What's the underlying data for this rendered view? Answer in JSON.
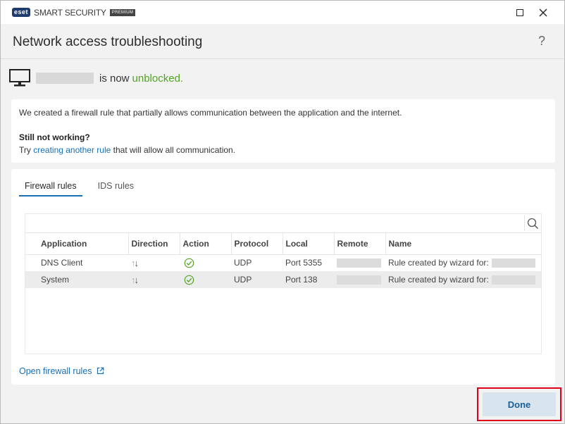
{
  "titlebar": {
    "logo_brand": "eset",
    "logo_product": "SMART SECURITY",
    "logo_edition": "PREMIUM"
  },
  "header": {
    "title": "Network access troubleshooting",
    "help_label": "?"
  },
  "status": {
    "suffix": "is now",
    "state": "unblocked."
  },
  "info": {
    "description": "We created a firewall rule that partially allows communication between the application and the internet.",
    "heading": "Still not working?",
    "try_prefix": "Try",
    "try_link": "creating another rule",
    "try_suffix": "that will allow all communication."
  },
  "tabs": [
    {
      "label": "Firewall rules",
      "active": true
    },
    {
      "label": "IDS rules",
      "active": false
    }
  ],
  "table": {
    "columns": [
      "Application",
      "Direction",
      "Action",
      "Protocol",
      "Local",
      "Remote",
      "Name"
    ],
    "rows": [
      {
        "application": "DNS Client",
        "direction": "both",
        "action": "allow",
        "protocol": "UDP",
        "local": "Port 5355",
        "name": "Rule created by wizard for:"
      },
      {
        "application": "System",
        "direction": "both",
        "action": "allow",
        "protocol": "UDP",
        "local": "Port 138",
        "name": "Rule created by wizard for:"
      }
    ]
  },
  "links": {
    "open_firewall_rules": "Open firewall rules"
  },
  "footer": {
    "done_label": "Done"
  },
  "colors": {
    "accent": "#1a6fb3",
    "success": "#54a224",
    "highlight": "#e0001b"
  }
}
